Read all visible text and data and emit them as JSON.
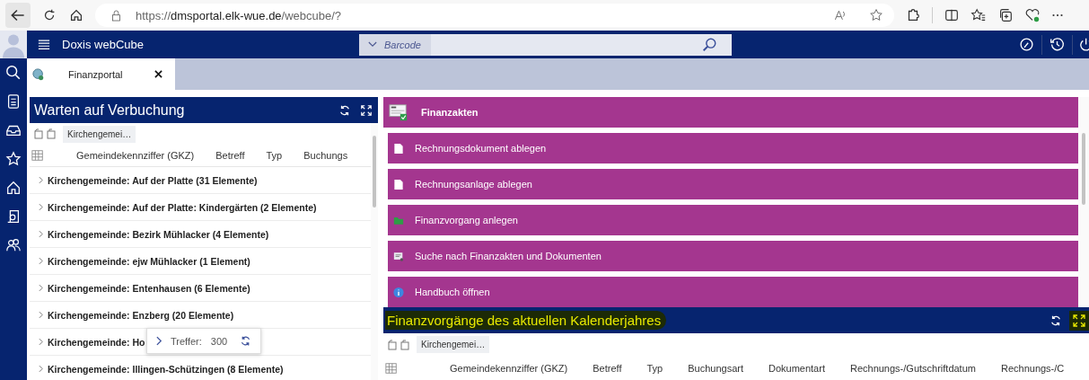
{
  "browser": {
    "url_scheme": "https://",
    "url_host": "dmsportal.elk-wue.de",
    "url_path": "/webcube/?"
  },
  "app": {
    "title": "Doxis webCube",
    "search": {
      "dropdown": "Barcode"
    }
  },
  "tabs": [
    {
      "label": "Finanzportal",
      "selected": true
    }
  ],
  "left_panel": {
    "title": "Warten auf Verbuchung",
    "filter_chip": "Kirchengemei…",
    "columns": [
      "Gemeindekennziffer (GKZ)",
      "Betreff",
      "Typ",
      "Buchungs"
    ],
    "groups": [
      {
        "label": "Kirchengemeinde: Auf der Platte (31 Elemente)"
      },
      {
        "label": "Kirchengemeinde: Auf der Platte: Kindergärten (2 Elemente)"
      },
      {
        "label": "Kirchengemeinde: Bezirk Mühlacker (4 Elemente)"
      },
      {
        "label": "Kirchengemeinde: ejw Mühlacker (1 Element)"
      },
      {
        "label": "Kirchengemeinde: Entenhausen (6 Elemente)"
      },
      {
        "label": "Kirchengemeinde: Enzberg (20 Elemente)"
      },
      {
        "label": "Kirchengemeinde: Ho"
      },
      {
        "label": "Kirchengemeinde: Illingen-Schützingen (8 Elemente)"
      }
    ],
    "hits": {
      "label": "Treffer:",
      "count": "300"
    }
  },
  "right_panel": {
    "title": "Finanzakten",
    "actions": [
      {
        "label": "Rechnungsdokument ablegen",
        "kind": "document"
      },
      {
        "label": "Rechnungsanlage ablegen",
        "kind": "document"
      },
      {
        "label": "Finanzvorgang anlegen",
        "kind": "folder"
      },
      {
        "label": "Suche nach Finanzakten und Dokumenten",
        "kind": "search"
      },
      {
        "label": "Handbuch öffnen",
        "kind": "info"
      }
    ]
  },
  "bottom_panel": {
    "title": "Finanzvorgänge des aktuellen Kalenderjahres",
    "highlighted": true,
    "filter_chip": "Kirchengemei…",
    "columns": [
      "Gemeindekennziffer (GKZ)",
      "Betreff",
      "Typ",
      "Buchungsart",
      "Dokumentart",
      "Rechnungs-/Gutschriftdatum",
      "Rechnungs-/C"
    ]
  }
}
